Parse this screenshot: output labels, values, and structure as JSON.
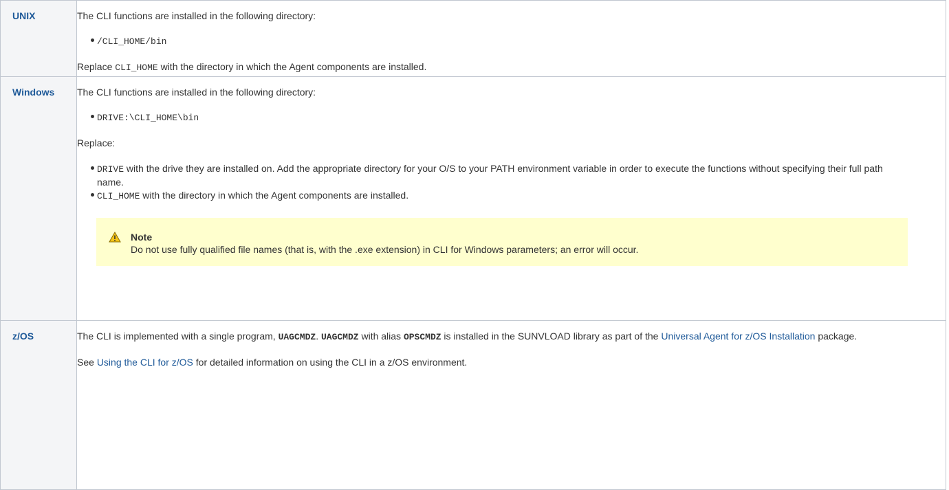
{
  "rows": [
    {
      "os": "UNIX",
      "intro": "The CLI functions are installed in the following directory:",
      "path": "/CLI_HOME/bin",
      "replace_code": "CLI_HOME",
      "replace_text": " with the directory in which the Agent components are installed."
    },
    {
      "os": "Windows",
      "intro": "The CLI functions are installed in the following directory:",
      "path": "DRIVE:\\CLI_HOME\\bin",
      "replace_label": "Replace:",
      "items": [
        {
          "code": "DRIVE",
          "text": " with the drive they are installed on. Add the appropriate directory for your O/S to your PATH environment variable in order to execute the functions without specifying their full path name."
        },
        {
          "code": "CLI_HOME",
          "text": " with the directory in which the Agent components are installed."
        }
      ],
      "note": {
        "title": "Note",
        "text": "Do not use fully qualified file names (that is, with the .exe extension) in CLI for Windows parameters; an error will occur."
      }
    },
    {
      "os": "z/OS",
      "p1_a": "The CLI is implemented with a single program, ",
      "program": "UAGCMDZ",
      "p1_b": ". ",
      "program2": "UAGCMDZ",
      "p1_c": " with alias ",
      "alias": "OPSCMDZ",
      "p1_d": " is installed in the SUNVLOAD library as part of the ",
      "link1": "Universal Agent for z/OS Installation",
      "p1_e": " package.",
      "p2_a": "See ",
      "link2": "Using the CLI for z/OS",
      "p2_b": " for detailed information on using the CLI in a z/OS environment."
    }
  ]
}
